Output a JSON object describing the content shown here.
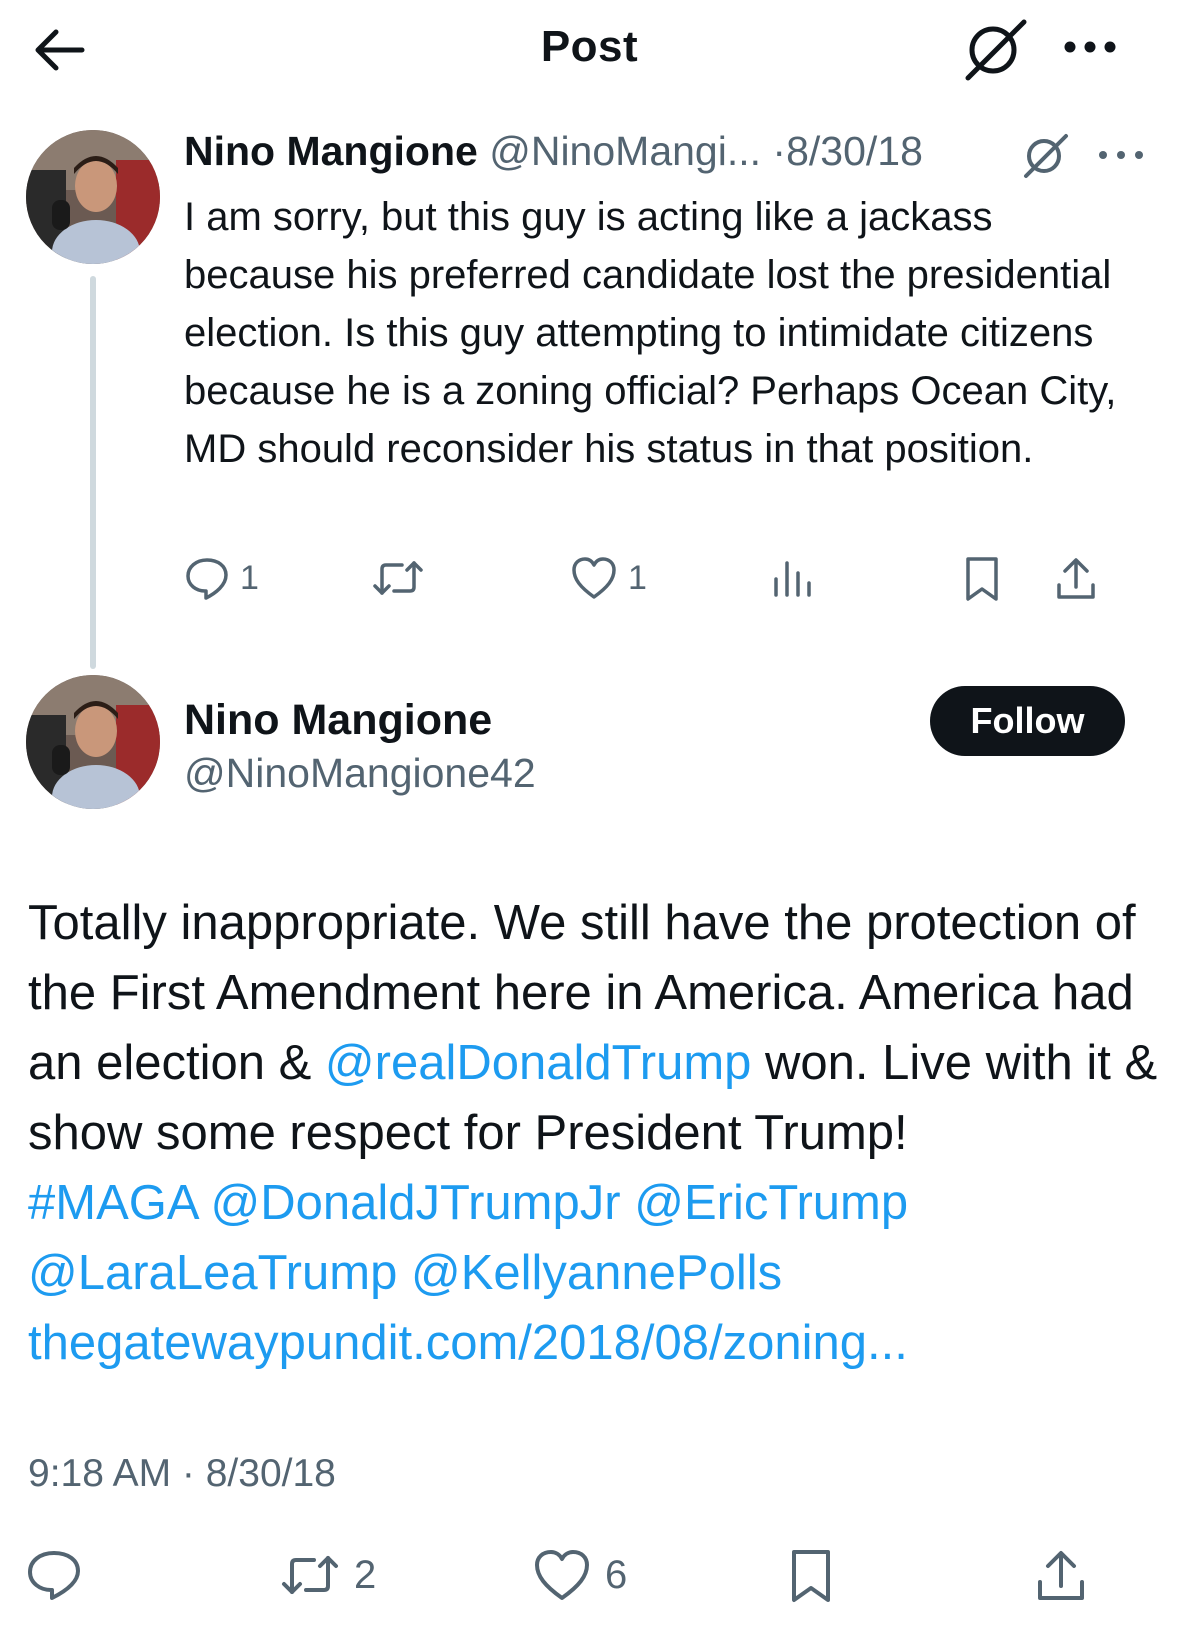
{
  "header": {
    "title": "Post",
    "back_icon": "arrow-left-icon",
    "grok_icon": "grok-icon",
    "more_icon": "more-horizontal-icon"
  },
  "parent_post": {
    "author_name": "Nino Mangione",
    "author_handle_truncated": "@NinoMangi...",
    "date": "8/30/18",
    "text": "I am sorry, but this guy is acting like a jackass because his preferred candidate lost the presidential election. Is this guy attempting to intimidate citizens because he is a zoning official? Perhaps Ocean City, MD should reconsider his status in that position.",
    "reply_count": "1",
    "repost_count": "",
    "like_count": "1"
  },
  "main_post": {
    "author_name": "Nino Mangione",
    "author_handle": "@NinoMangione42",
    "follow_label": "Follow",
    "text_1": "Totally inappropriate. We still have the protection of the First Amendment here in America. America had an election & ",
    "mention_1": "@realDonaldTrump",
    "text_2": " won. Live with it & show some respect for President Trump! ",
    "hashtag_1": "#MAGA",
    "mention_2": "@DonaldJTrumpJr",
    "mention_3": "@EricTrump",
    "mention_4": "@LaraLeaTrump",
    "mention_5": "@KellyannePolls",
    "link_1": "thegatewaypundit.com/2018/08/zoning...",
    "timestamp": "9:18 AM · 8/30/18",
    "repost_count": "2",
    "like_count": "6"
  },
  "colors": {
    "link": "#1d9bf0",
    "secondary_text": "#536471",
    "primary_text": "#0f1419",
    "thread_line": "#cfd9de"
  }
}
